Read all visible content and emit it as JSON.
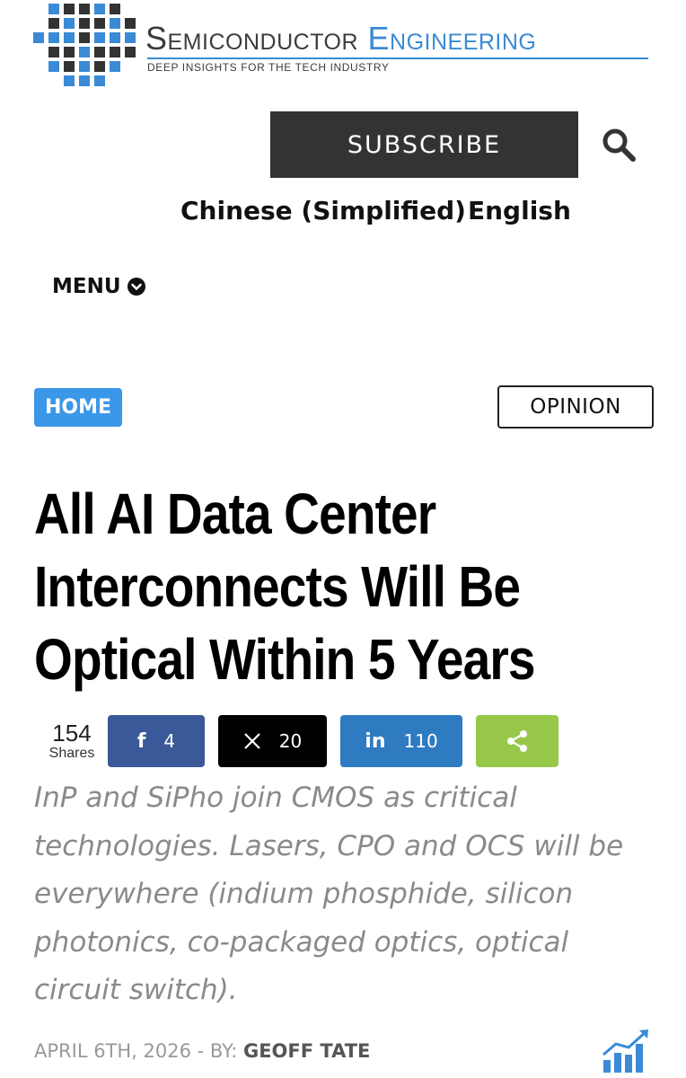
{
  "header": {
    "brand_word1": "Semiconductor",
    "brand_word2": "Engineering",
    "tagline": "DEEP INSIGHTS FOR THE TECH INDUSTRY",
    "subscribe_label": "SUBSCRIBE",
    "search_icon": "search-icon"
  },
  "languages": [
    "Chinese (Simplified)",
    "English"
  ],
  "menu": {
    "label": "MENU",
    "icon": "chevron-down-circle-icon"
  },
  "badges": {
    "home": "HOME",
    "category": "OPINION"
  },
  "article": {
    "title": "All AI Data Center Interconnects Will Be Optical Within 5 Years",
    "dek": "InP and SiPho join CMOS as critical technologies. Lasers, CPO and OCS will be everywhere (indium phosphide, silicon photonics, co-packaged optics, optical circuit switch).",
    "date": "APRIL 6TH, 2026",
    "by_prefix": "- BY:",
    "author": "GEOFF TATE"
  },
  "share": {
    "total": "154",
    "total_label": "Shares",
    "facebook": "4",
    "x": "20",
    "linkedin": "110"
  },
  "colors": {
    "brand_blue": "#3a8ad6",
    "subscribe_bg": "#333333",
    "home_badge": "#3b97e8",
    "facebook": "#3b5998",
    "x": "#000000",
    "linkedin": "#2f7bc1",
    "share": "#97c84a"
  }
}
